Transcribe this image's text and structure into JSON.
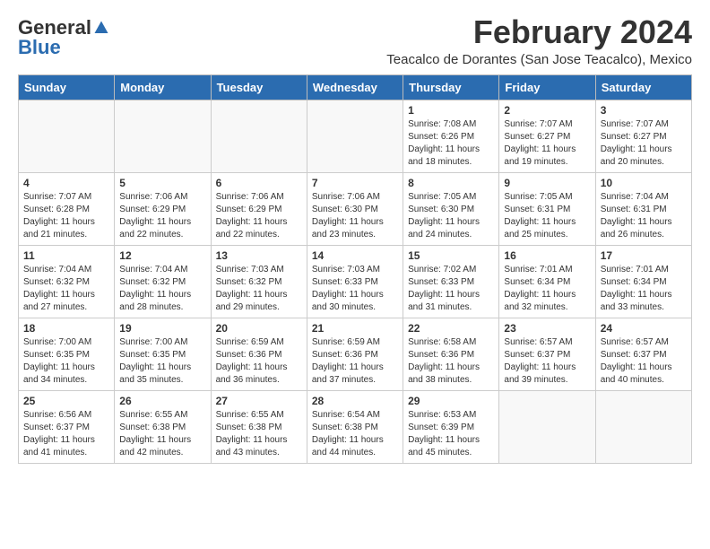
{
  "logo": {
    "general": "General",
    "blue": "Blue"
  },
  "title": "February 2024",
  "subtitle": "Teacalco de Dorantes (San Jose Teacalco), Mexico",
  "days_of_week": [
    "Sunday",
    "Monday",
    "Tuesday",
    "Wednesday",
    "Thursday",
    "Friday",
    "Saturday"
  ],
  "weeks": [
    [
      {
        "day": "",
        "info": ""
      },
      {
        "day": "",
        "info": ""
      },
      {
        "day": "",
        "info": ""
      },
      {
        "day": "",
        "info": ""
      },
      {
        "day": "1",
        "info": "Sunrise: 7:08 AM\nSunset: 6:26 PM\nDaylight: 11 hours\nand 18 minutes."
      },
      {
        "day": "2",
        "info": "Sunrise: 7:07 AM\nSunset: 6:27 PM\nDaylight: 11 hours\nand 19 minutes."
      },
      {
        "day": "3",
        "info": "Sunrise: 7:07 AM\nSunset: 6:27 PM\nDaylight: 11 hours\nand 20 minutes."
      }
    ],
    [
      {
        "day": "4",
        "info": "Sunrise: 7:07 AM\nSunset: 6:28 PM\nDaylight: 11 hours\nand 21 minutes."
      },
      {
        "day": "5",
        "info": "Sunrise: 7:06 AM\nSunset: 6:29 PM\nDaylight: 11 hours\nand 22 minutes."
      },
      {
        "day": "6",
        "info": "Sunrise: 7:06 AM\nSunset: 6:29 PM\nDaylight: 11 hours\nand 22 minutes."
      },
      {
        "day": "7",
        "info": "Sunrise: 7:06 AM\nSunset: 6:30 PM\nDaylight: 11 hours\nand 23 minutes."
      },
      {
        "day": "8",
        "info": "Sunrise: 7:05 AM\nSunset: 6:30 PM\nDaylight: 11 hours\nand 24 minutes."
      },
      {
        "day": "9",
        "info": "Sunrise: 7:05 AM\nSunset: 6:31 PM\nDaylight: 11 hours\nand 25 minutes."
      },
      {
        "day": "10",
        "info": "Sunrise: 7:04 AM\nSunset: 6:31 PM\nDaylight: 11 hours\nand 26 minutes."
      }
    ],
    [
      {
        "day": "11",
        "info": "Sunrise: 7:04 AM\nSunset: 6:32 PM\nDaylight: 11 hours\nand 27 minutes."
      },
      {
        "day": "12",
        "info": "Sunrise: 7:04 AM\nSunset: 6:32 PM\nDaylight: 11 hours\nand 28 minutes."
      },
      {
        "day": "13",
        "info": "Sunrise: 7:03 AM\nSunset: 6:32 PM\nDaylight: 11 hours\nand 29 minutes."
      },
      {
        "day": "14",
        "info": "Sunrise: 7:03 AM\nSunset: 6:33 PM\nDaylight: 11 hours\nand 30 minutes."
      },
      {
        "day": "15",
        "info": "Sunrise: 7:02 AM\nSunset: 6:33 PM\nDaylight: 11 hours\nand 31 minutes."
      },
      {
        "day": "16",
        "info": "Sunrise: 7:01 AM\nSunset: 6:34 PM\nDaylight: 11 hours\nand 32 minutes."
      },
      {
        "day": "17",
        "info": "Sunrise: 7:01 AM\nSunset: 6:34 PM\nDaylight: 11 hours\nand 33 minutes."
      }
    ],
    [
      {
        "day": "18",
        "info": "Sunrise: 7:00 AM\nSunset: 6:35 PM\nDaylight: 11 hours\nand 34 minutes."
      },
      {
        "day": "19",
        "info": "Sunrise: 7:00 AM\nSunset: 6:35 PM\nDaylight: 11 hours\nand 35 minutes."
      },
      {
        "day": "20",
        "info": "Sunrise: 6:59 AM\nSunset: 6:36 PM\nDaylight: 11 hours\nand 36 minutes."
      },
      {
        "day": "21",
        "info": "Sunrise: 6:59 AM\nSunset: 6:36 PM\nDaylight: 11 hours\nand 37 minutes."
      },
      {
        "day": "22",
        "info": "Sunrise: 6:58 AM\nSunset: 6:36 PM\nDaylight: 11 hours\nand 38 minutes."
      },
      {
        "day": "23",
        "info": "Sunrise: 6:57 AM\nSunset: 6:37 PM\nDaylight: 11 hours\nand 39 minutes."
      },
      {
        "day": "24",
        "info": "Sunrise: 6:57 AM\nSunset: 6:37 PM\nDaylight: 11 hours\nand 40 minutes."
      }
    ],
    [
      {
        "day": "25",
        "info": "Sunrise: 6:56 AM\nSunset: 6:37 PM\nDaylight: 11 hours\nand 41 minutes."
      },
      {
        "day": "26",
        "info": "Sunrise: 6:55 AM\nSunset: 6:38 PM\nDaylight: 11 hours\nand 42 minutes."
      },
      {
        "day": "27",
        "info": "Sunrise: 6:55 AM\nSunset: 6:38 PM\nDaylight: 11 hours\nand 43 minutes."
      },
      {
        "day": "28",
        "info": "Sunrise: 6:54 AM\nSunset: 6:38 PM\nDaylight: 11 hours\nand 44 minutes."
      },
      {
        "day": "29",
        "info": "Sunrise: 6:53 AM\nSunset: 6:39 PM\nDaylight: 11 hours\nand 45 minutes."
      },
      {
        "day": "",
        "info": ""
      },
      {
        "day": "",
        "info": ""
      }
    ]
  ]
}
